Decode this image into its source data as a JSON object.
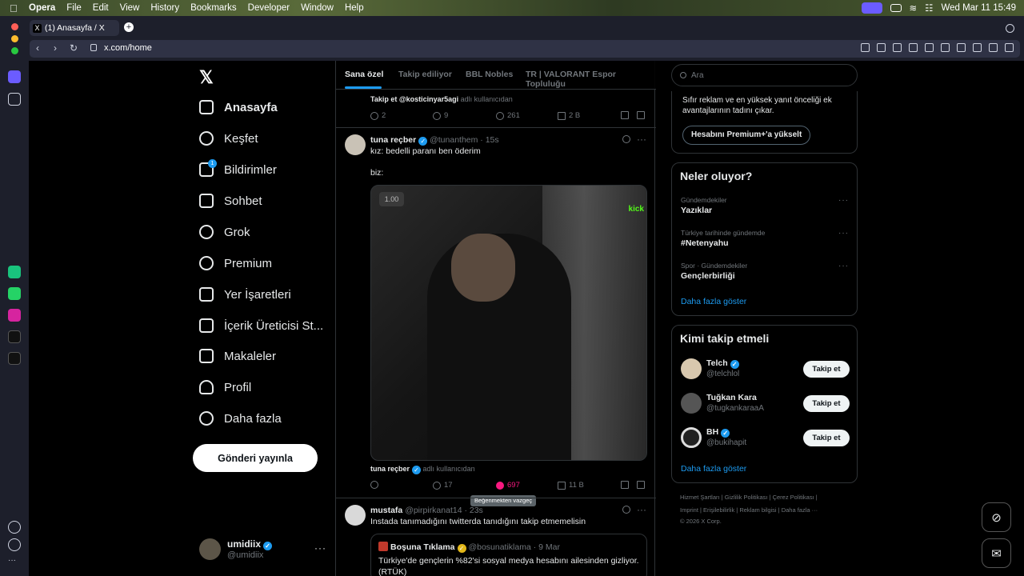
{
  "menubar": {
    "app": "Opera",
    "items": [
      "File",
      "Edit",
      "View",
      "History",
      "Bookmarks",
      "Developer",
      "Window",
      "Help"
    ],
    "datetime": "Wed Mar 11  15:49"
  },
  "browser": {
    "tab_title": "(1) Anasayfa / X",
    "url": "x.com/home",
    "accent": "#1d9bf0"
  },
  "nav": {
    "items": [
      {
        "label": "Anasayfa",
        "icon": "home-icon"
      },
      {
        "label": "Keşfet",
        "icon": "search-icon"
      },
      {
        "label": "Bildirimler",
        "icon": "bell-icon",
        "badge": "1"
      },
      {
        "label": "Sohbet",
        "icon": "envelope-icon"
      },
      {
        "label": "Grok",
        "icon": "grok-icon"
      },
      {
        "label": "Premium",
        "icon": "premium-icon"
      },
      {
        "label": "Yer İşaretleri",
        "icon": "bookmark-icon"
      },
      {
        "label": "İçerik Üreticisi St...",
        "icon": "creator-icon"
      },
      {
        "label": "Makaleler",
        "icon": "articles-icon"
      },
      {
        "label": "Profil",
        "icon": "profile-icon"
      },
      {
        "label": "Daha fazla",
        "icon": "more-circle-icon"
      }
    ],
    "post_button": "Gönderi yayınla",
    "account": {
      "name": "umidiix",
      "handle": "@umidiix"
    }
  },
  "tabs": [
    "Sana özel",
    "Takip ediliyor",
    "BBL Nobles",
    "TR | VALORANT Espor Topluluğu"
  ],
  "feed": {
    "prev_tweet": {
      "tagged": "Takip et @kosticinyar5agi",
      "tagged_suffix": "adlı kullanıcıdan",
      "replies": "2",
      "retweets": "9",
      "likes": "261",
      "views": "2 B"
    },
    "tweet1": {
      "name": "tuna reçber",
      "handle": "@tunanthem · 15s",
      "line1": "kız: bedelli paranı ben öderim",
      "line2": "biz:",
      "media_rate": "1.00",
      "media_brand": "kick",
      "tagged": "tuna reçber",
      "tagged_suffix": "adlı kullanıcıdan",
      "replies": "",
      "retweets": "17",
      "likes": "697",
      "views": "11 B",
      "tooltip": "Beğenmekten vazgeç"
    },
    "tweet2": {
      "name": "mustafa",
      "handle": "@pirpirkanat14 · 23s",
      "text": "Instada tanımadığını twitterda tanıdığını takip etmemelisin",
      "quote_name": "Boşuna Tıklama",
      "quote_handle": "@bosunatiklama · 9 Mar",
      "quote_text": "Türkiye'de gençlerin %82'si sosyal medya hesabını ailesinden gizliyor.",
      "quote_text2": "(RTÜK)"
    }
  },
  "right": {
    "search_placeholder": "Ara",
    "premium_text": "Sıfır reklam ve en yüksek yanıt önceliği ek avantajlarının tadını çıkar.",
    "premium_button": "Hesabını Premium+'a yükselt",
    "trends_title": "Neler oluyor?",
    "trends": [
      {
        "category": "Gündemdekiler",
        "name": "Yazıklar"
      },
      {
        "category": "Türkiye tarihinde gündemde",
        "name": "#Netenyahu"
      },
      {
        "category": "Spor · Gündemdekiler",
        "name": "Gençlerbirliği"
      }
    ],
    "show_more": "Daha fazla göster",
    "wtf_title": "Kimi takip etmeli",
    "wtf": [
      {
        "name": "Telch",
        "handle": "@telchlol",
        "button": "Takip et"
      },
      {
        "name": "Tuğkan Kara",
        "handle": "@tugkankaraaA",
        "button": "Takip et"
      },
      {
        "name": "BH",
        "handle": "@bukihapit",
        "button": "Takip et"
      }
    ],
    "footer_line1": "Hizmet Şartları  |  Gizlilik Politikası  |  Çerez Politikası  |",
    "footer_line2": "Imprint  |  Erişilebilirlik  |  Reklam bilgisi  |  Daha fazla ···",
    "footer_line3": "© 2026 X Corp."
  }
}
